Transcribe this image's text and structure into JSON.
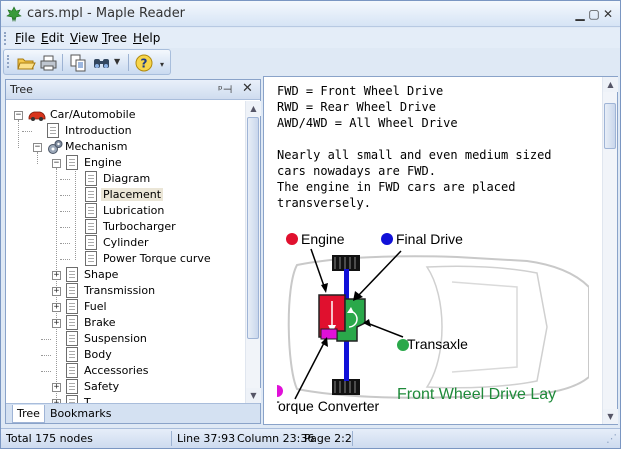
{
  "window": {
    "title": "cars.mpl - Maple Reader"
  },
  "menu": [
    {
      "label": "File",
      "ul": "F",
      "rest": "ile"
    },
    {
      "label": "Edit",
      "ul": "E",
      "rest": "dit"
    },
    {
      "label": "View",
      "ul": "V",
      "rest": "iew"
    },
    {
      "label": "Tree",
      "ul": "T",
      "rest": "ree"
    },
    {
      "label": "Help",
      "ul": "H",
      "rest": "elp"
    }
  ],
  "toolbar": {
    "icons": [
      "open-folder-icon",
      "print-icon",
      "copy-icon",
      "find-icon",
      "help-icon"
    ]
  },
  "tree_panel": {
    "title": "Tree",
    "tabs": [
      "Tree",
      "Bookmarks"
    ],
    "nodes": [
      {
        "label": "Car/Automobile",
        "level": 0,
        "expander": "-",
        "icon": "car-icon"
      },
      {
        "label": "Introduction",
        "level": 1,
        "expander": "",
        "icon": "doc-icon"
      },
      {
        "label": "Mechanism",
        "level": 1,
        "expander": "-",
        "icon": "gears-icon"
      },
      {
        "label": "Engine",
        "level": 2,
        "expander": "-",
        "icon": "doc-icon"
      },
      {
        "label": "Diagram",
        "level": 3,
        "expander": "",
        "icon": "doc-icon"
      },
      {
        "label": "Placement",
        "level": 3,
        "expander": "",
        "icon": "doc-icon",
        "selected": true
      },
      {
        "label": "Lubrication",
        "level": 3,
        "expander": "",
        "icon": "doc-icon"
      },
      {
        "label": "Turbocharger",
        "level": 3,
        "expander": "",
        "icon": "doc-icon"
      },
      {
        "label": "Cylinder",
        "level": 3,
        "expander": "",
        "icon": "doc-icon"
      },
      {
        "label": "Power Torque curve",
        "level": 3,
        "expander": "",
        "icon": "doc-icon"
      },
      {
        "label": "Shape",
        "level": 2,
        "expander": "+",
        "icon": "doc-icon"
      },
      {
        "label": "Transmission",
        "level": 2,
        "expander": "+",
        "icon": "doc-icon"
      },
      {
        "label": "Fuel",
        "level": 2,
        "expander": "+",
        "icon": "doc-icon"
      },
      {
        "label": "Brake",
        "level": 2,
        "expander": "+",
        "icon": "doc-icon"
      },
      {
        "label": "Suspension",
        "level": 2,
        "expander": "",
        "icon": "doc-icon"
      },
      {
        "label": "Body",
        "level": 2,
        "expander": "",
        "icon": "doc-icon"
      },
      {
        "label": "Accessories",
        "level": 2,
        "expander": "",
        "icon": "doc-icon"
      },
      {
        "label": "Safety",
        "level": 2,
        "expander": "+",
        "icon": "doc-icon"
      },
      {
        "label": "T...",
        "level": 2,
        "expander": "+",
        "icon": "doc-icon"
      }
    ]
  },
  "content": {
    "lines": [
      "FWD = Front Wheel Drive",
      "RWD = Rear Wheel Drive",
      "AWD/4WD = All Wheel Drive",
      "",
      "Nearly all small and even medium sized",
      "cars nowadays are FWD.",
      "The engine in FWD cars are placed",
      "transversely."
    ],
    "diagram": {
      "labels": {
        "engine": "Engine",
        "final_drive": "Final Drive",
        "transaxle": "Transaxle",
        "torque_converter": "Torque Converter",
        "caption": "Front Wheel Drive Lay"
      },
      "colors": {
        "engine": "#e0102e",
        "final_drive": "#1010d8",
        "transaxle": "#2aa84a",
        "torque_converter": "#e010d8",
        "caption": "#1f8a3a"
      }
    }
  },
  "status": {
    "nodes": "Total 175 nodes",
    "line": "Line 37:93",
    "column": "Column 23:36",
    "page": "Page 2:2"
  }
}
